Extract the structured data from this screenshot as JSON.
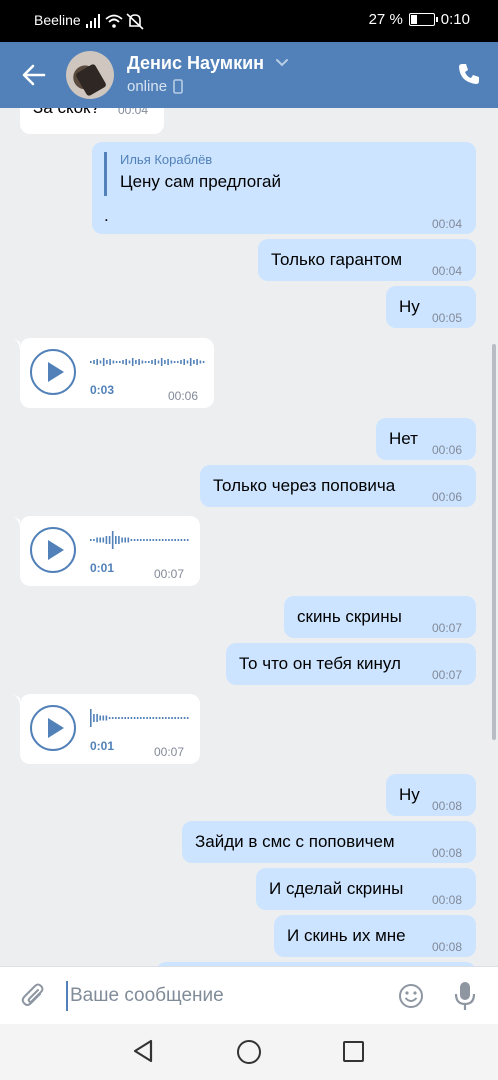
{
  "status_bar": {
    "carrier": "Beeline",
    "battery": "27 %",
    "battery_level": 0.27,
    "time": "0:10"
  },
  "header": {
    "contact_name": "Денис Наумкин",
    "status": "online"
  },
  "messages": [
    {
      "dir": "in",
      "text": "За скок?",
      "time": "00:04"
    },
    {
      "dir": "out",
      "reply_author": "Илья Кораблёв",
      "reply_text": "Цену сам предлогай",
      "text": ".",
      "time": "00:04"
    },
    {
      "dir": "out",
      "text": "Только гарантом",
      "time": "00:04"
    },
    {
      "dir": "out",
      "text": "Ну",
      "time": "00:05"
    },
    {
      "dir": "in",
      "type": "voice",
      "duration": "0:03",
      "time": "00:06"
    },
    {
      "dir": "out",
      "text": "Нет",
      "time": "00:06"
    },
    {
      "dir": "out",
      "text": "Только через поповича",
      "time": "00:06"
    },
    {
      "dir": "in",
      "type": "voice",
      "duration": "0:01",
      "time": "00:07"
    },
    {
      "dir": "out",
      "text": "скинь скрины",
      "time": "00:07"
    },
    {
      "dir": "out",
      "text": "То что он тебя кинул",
      "time": "00:07"
    },
    {
      "dir": "in",
      "type": "voice",
      "duration": "0:01",
      "time": "00:07"
    },
    {
      "dir": "out",
      "text": "Ну",
      "time": "00:08"
    },
    {
      "dir": "out",
      "text": "Зайди в смс с поповичем",
      "time": "00:08"
    },
    {
      "dir": "out",
      "text": "И сделай скрины",
      "time": "00:08"
    },
    {
      "dir": "out",
      "text": "И скинь их мне",
      "time": "00:08"
    }
  ],
  "composer": {
    "placeholder": "Ваше сообщение"
  },
  "colors": {
    "header": "#5181b8",
    "bubble_out": "#cce4ff",
    "bubble_in": "#ffffff",
    "background": "#edeef0"
  }
}
